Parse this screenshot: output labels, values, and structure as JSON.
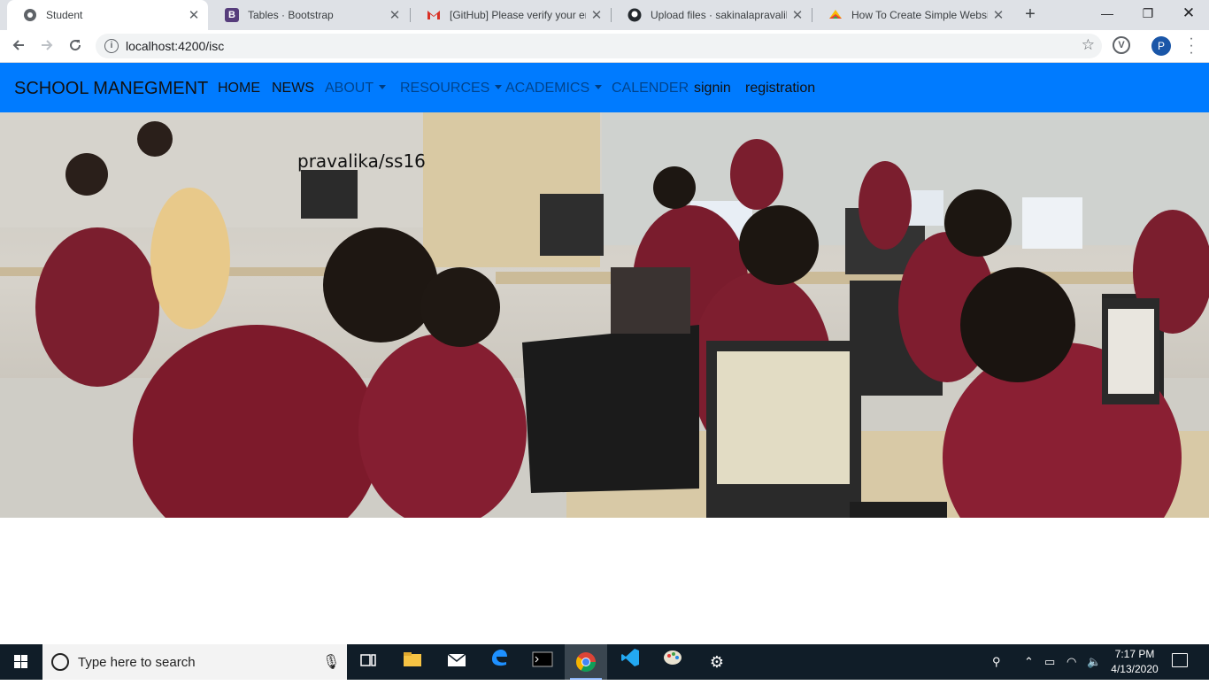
{
  "browser": {
    "tabs": [
      {
        "title": "Student",
        "favicon": "globe-icon",
        "close": "✕"
      },
      {
        "title": "Tables · Bootstrap",
        "favicon": "bootstrap-icon",
        "close": "✕"
      },
      {
        "title": "[GitHub] Please verify your em",
        "favicon": "gmail-icon",
        "close": "✕"
      },
      {
        "title": "Upload files · sakinalapravalika",
        "favicon": "github-icon",
        "close": "✕"
      },
      {
        "title": "How To Create Simple Website",
        "favicon": "colorful-icon",
        "close": "✕"
      }
    ],
    "url": "localhost:4200/isc",
    "profile_initial": "P"
  },
  "navbar": {
    "brand": "SCHOOL MANEGMENT",
    "items": [
      {
        "label": "HOME"
      },
      {
        "label": "NEWS"
      },
      {
        "label": "ABOUT"
      },
      {
        "label": "RESOURCES"
      },
      {
        "label": "ACADEMICS"
      },
      {
        "label": "CALENDER"
      },
      {
        "label": "signin"
      },
      {
        "label": "registration"
      }
    ],
    "color": "#007bff"
  },
  "hero": {
    "overlay_text": "pravalika/ss16"
  },
  "taskbar": {
    "search_placeholder": "Type here to search",
    "time": "7:17 PM",
    "date": "4/13/2020"
  }
}
